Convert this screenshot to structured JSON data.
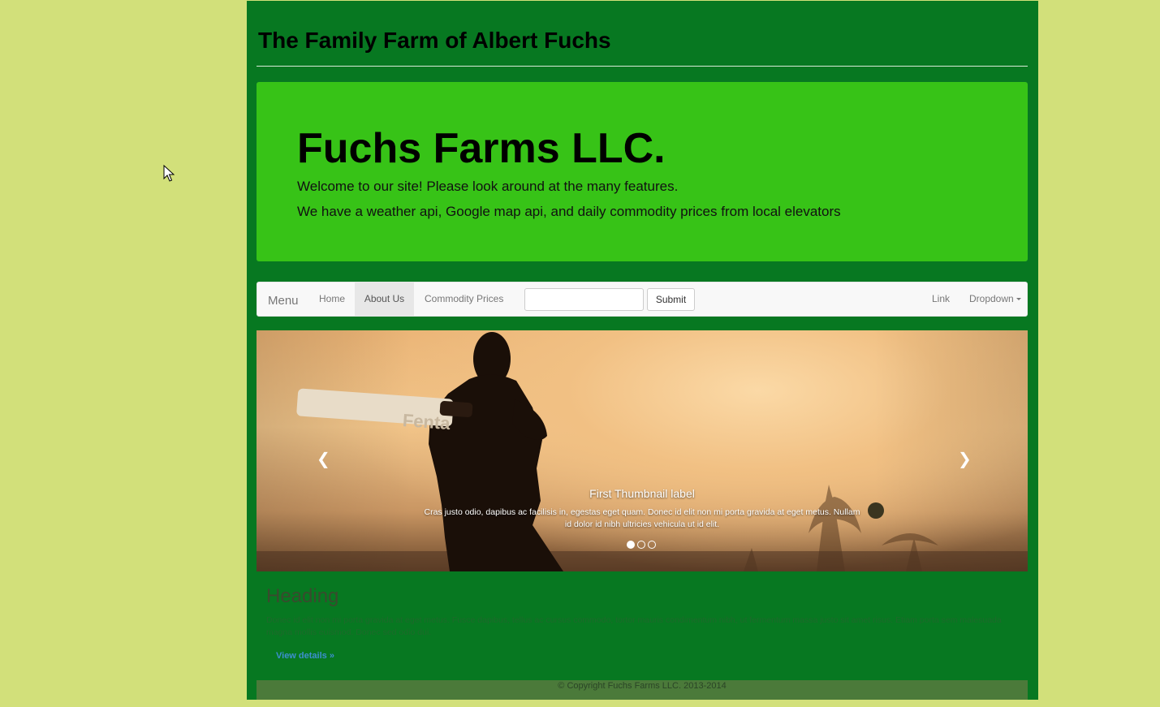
{
  "header": {
    "site_title": "The Family Farm of Albert Fuchs"
  },
  "jumbotron": {
    "heading": "Fuchs Farms LLC.",
    "line1": "Welcome to our site! Please look around at the many features.",
    "line2": "We have a weather api, Google map api, and daily commodity prices from local elevators"
  },
  "navbar": {
    "brand": "Menu",
    "items": [
      {
        "label": "Home",
        "active": false
      },
      {
        "label": "About Us",
        "active": true
      },
      {
        "label": "Commodity Prices",
        "active": false
      }
    ],
    "search": {
      "value": "",
      "placeholder": ""
    },
    "submit_label": "Submit",
    "right_link": "Link",
    "dropdown_label": "Dropdown"
  },
  "carousel": {
    "prev_icon": "chevron-left-icon",
    "next_icon": "chevron-right-icon",
    "caption_title": "First Thumbnail label",
    "caption_text": "Cras justo odio, dapibus ac facilisis in, egestas eget quam. Donec id elit non mi porta gravida at eget metus. Nullam id dolor id nibh ultricies vehicula ut id elit.",
    "bat_text": "Fenta",
    "slide_count": 3,
    "active_slide": 1
  },
  "content": {
    "heading": "Heading",
    "text": "Donec id elit non mi porta gravida at eget metus. Fusce dapibus, tellus ac cursus commodo, tortor mauris condimentum nibh, ut fermentum massa justo sit amet risus. Etiam porta sem malesuada magna mollis euismod. Donec sed odio dui.",
    "link": "View details »"
  },
  "footer": {
    "copyright": "© Copyright Fuchs Farms LLC. 2013-2014"
  },
  "colors": {
    "page_background": "#d2e07a",
    "container_background": "#077821",
    "jumbotron_background": "#37c317",
    "footer_background": "#4b7a3a",
    "link_color": "#3d8fd0"
  }
}
